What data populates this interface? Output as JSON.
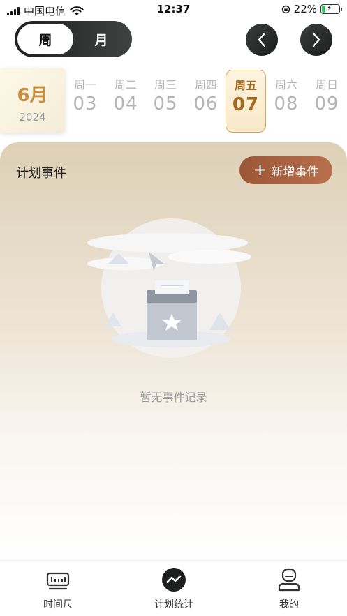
{
  "status_bar": {
    "carrier": "中国电信",
    "time": "12:37",
    "battery": "22%"
  },
  "view_toggle": {
    "week_label": "周",
    "month_label": "月",
    "active": "week"
  },
  "week_strip": {
    "month": "6月",
    "year": "2024",
    "days": [
      {
        "weekday": "周一",
        "date": "03"
      },
      {
        "weekday": "周二",
        "date": "04"
      },
      {
        "weekday": "周三",
        "date": "05"
      },
      {
        "weekday": "周四",
        "date": "06"
      },
      {
        "weekday": "周五",
        "date": "07",
        "selected": true
      },
      {
        "weekday": "周六",
        "date": "08"
      },
      {
        "weekday": "周日",
        "date": "09"
      }
    ]
  },
  "events": {
    "title": "计划事件",
    "add_label": "新增事件",
    "empty_text": "暂无事件记录"
  },
  "tabbar": {
    "items": [
      {
        "label": "时间尺",
        "icon": "ruler-icon"
      },
      {
        "label": "计划统计",
        "icon": "trend-icon",
        "active": true
      },
      {
        "label": "我的",
        "icon": "profile-icon"
      }
    ]
  },
  "colors": {
    "accent_gold": "#a56a1e",
    "add_button": "#a35e3e",
    "dark_control": "#2a2c2b"
  }
}
